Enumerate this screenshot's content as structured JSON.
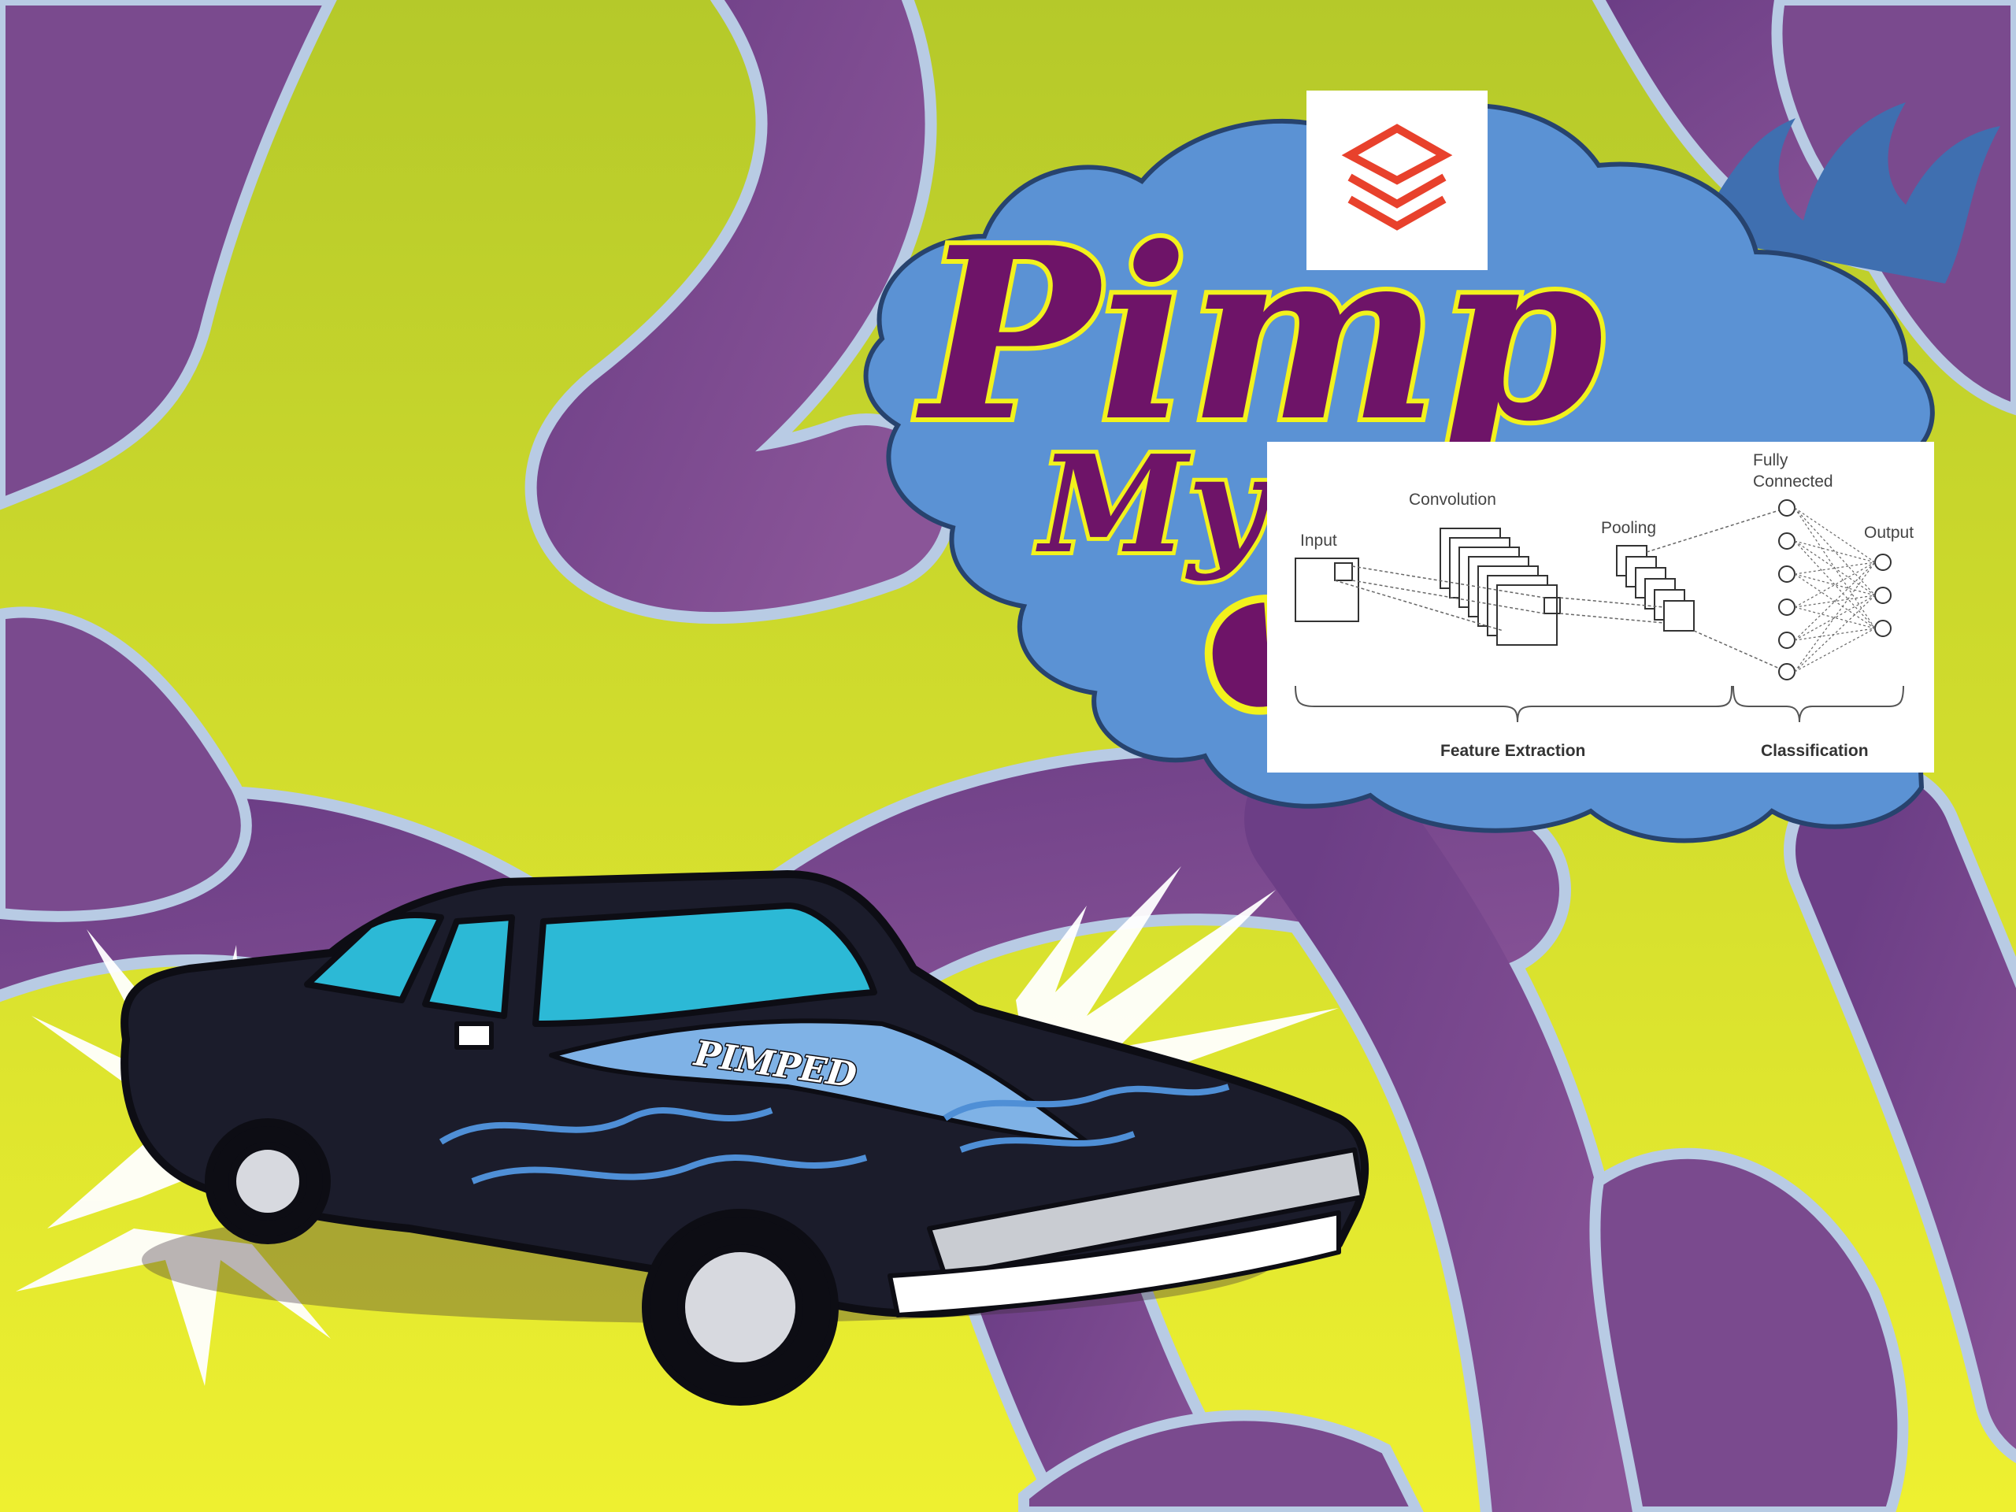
{
  "poster": {
    "title_line1": "Pimp",
    "title_line2": "My",
    "hood_text": "PIMPED",
    "colors": {
      "lime": "#c9d92e",
      "purple": "#7a4a8e",
      "light_blue": "#b8cbe4",
      "cloud_blue": "#5b92d4",
      "title_purple": "#6e1468",
      "title_outline": "#f2f21c",
      "logo_red": "#e8412c"
    }
  },
  "logo": {
    "icon": "stacked-layers-icon"
  },
  "diagram": {
    "input": "Input",
    "convolution": "Convolution",
    "pooling": "Pooling",
    "fully_connected_1": "Fully",
    "fully_connected_2": "Connected",
    "output": "Output",
    "feature_extraction": "Feature Extraction",
    "classification": "Classification"
  }
}
